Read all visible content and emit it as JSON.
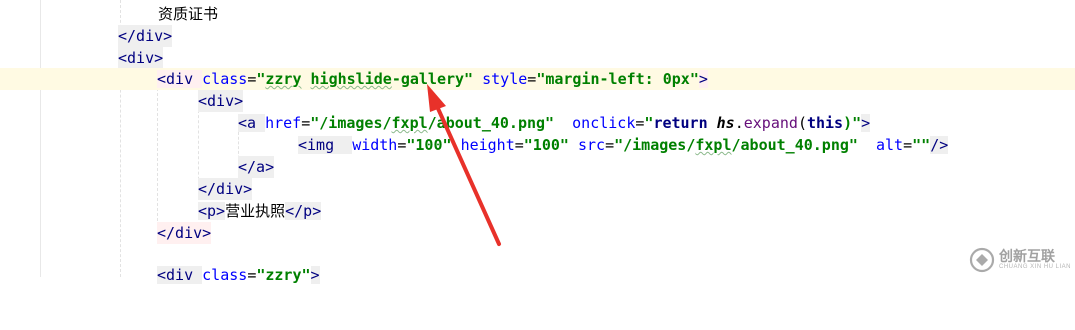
{
  "lines": {
    "l0": {
      "text": "资质证书"
    },
    "l1": {
      "close": "</div>"
    },
    "l2": {
      "open": "<div>"
    },
    "l3": {
      "open_lt": "<div ",
      "attr_class": "class",
      "eq1": "=",
      "val_class_q": "\"",
      "val_class_a": "zzry",
      "val_class_sp": " ",
      "val_class_b": "highslide",
      "val_class_c": "-gallery\"",
      "attr_style": "style",
      "eq2": "=",
      "val_style": "\"margin-left: 0px\"",
      "gt": ">"
    },
    "l4": {
      "open": "<div>"
    },
    "l5": {
      "open": "<a ",
      "attr_href": "href",
      "eq1": "=",
      "val_href_a": "\"/images/",
      "val_href_b": "fxpl",
      "val_href_c": "/about_40.png\"",
      "attr_onclick": "onclick",
      "eq2": "=",
      "q_open": "\"",
      "js_return": "return ",
      "js_hs": "hs",
      "js_dot": ".",
      "js_expand": "expand",
      "js_paren": "(",
      "js_this": "this",
      "js_close": ")\"",
      "gt": ">"
    },
    "l6": {
      "open": "<img  ",
      "attr_width": "width",
      "eq1": "=",
      "val_width": "\"100\"",
      "attr_height": "height",
      "eq2": "=",
      "val_height": "\"100\"",
      "attr_src": "src",
      "eq3": "=",
      "val_src_a": "\"/images/",
      "val_src_b": "fxpl",
      "val_src_c": "/about_40.png\"",
      "attr_alt": "alt",
      "eq4": "=",
      "val_alt": "\"\"",
      "end": "/>"
    },
    "l7": {
      "close": "</a>"
    },
    "l8": {
      "close": "</div>"
    },
    "l9": {
      "open": "<p>",
      "text": "营业执照",
      "close": "</p>"
    },
    "l10": {
      "close": "</div>"
    },
    "l11": {
      "open_lt": "<div ",
      "attr_class": "class",
      "eq1": "=",
      "val_class": "\"zzry\"",
      "gt": ">"
    }
  },
  "watermark": {
    "cn": "创新互联",
    "en": "CHUANG XIN HU LIAN"
  },
  "colors": {
    "annotation_arrow": "#e8312a",
    "current_line": "#fffae3"
  }
}
